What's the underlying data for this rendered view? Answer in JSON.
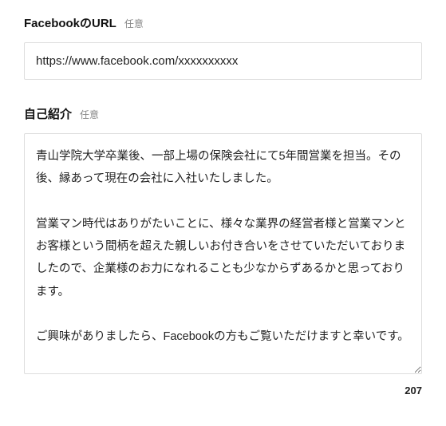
{
  "fields": {
    "facebook": {
      "label": "FacebookのURL",
      "optional": "任意",
      "value": "https://www.facebook.com/xxxxxxxxxx"
    },
    "bio": {
      "label": "自己紹介",
      "optional": "任意",
      "value": "青山学院大学卒業後、一部上場の保険会社にて5年間営業を担当。その後、縁あって現在の会社に入社いたしました。\n\n営業マン時代はありがたいことに、様々な業界の経営者様と営業マンとお客様という間柄を超えた親しいお付き合いをさせていただいておりましたので、企業様のお力になれることも少なからずあるかと思っております。\n\nご興味がありましたら、Facebookの方もご覧いただけますと幸いです。",
      "counter": "207"
    }
  }
}
